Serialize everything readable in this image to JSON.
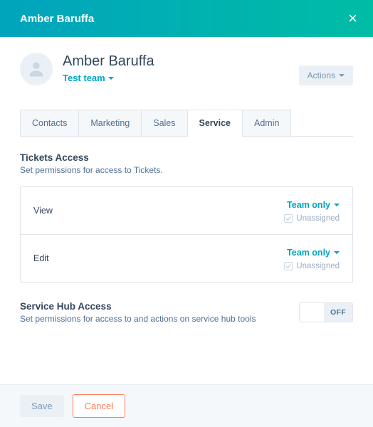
{
  "header": {
    "title": "Amber Baruffa"
  },
  "user": {
    "name": "Amber Baruffa",
    "team": "Test team",
    "actions_label": "Actions"
  },
  "tabs": [
    {
      "label": "Contacts"
    },
    {
      "label": "Marketing"
    },
    {
      "label": "Sales"
    },
    {
      "label": "Service"
    },
    {
      "label": "Admin"
    }
  ],
  "tickets": {
    "title": "Tickets Access",
    "subtitle": "Set permissions for access to Tickets.",
    "rows": [
      {
        "label": "View",
        "scope": "Team only",
        "unassigned": "Unassigned"
      },
      {
        "label": "Edit",
        "scope": "Team only",
        "unassigned": "Unassigned"
      }
    ]
  },
  "hub": {
    "title": "Service Hub Access",
    "subtitle": "Set permissions for access to and actions on service hub tools",
    "toggle": "OFF"
  },
  "footer": {
    "save": "Save",
    "cancel": "Cancel"
  }
}
